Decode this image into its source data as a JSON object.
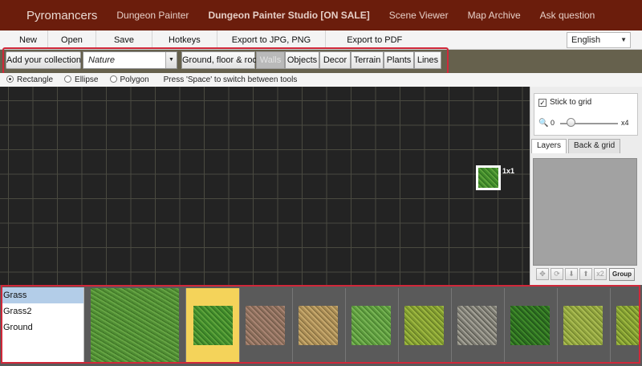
{
  "topnav": {
    "brand": "Pyromancers",
    "items": [
      "Dungeon Painter",
      "Dungeon Painter Studio [ON SALE]",
      "Scene Viewer",
      "Map Archive",
      "Ask question"
    ]
  },
  "menubar": {
    "items": [
      "New",
      "Open",
      "Save",
      "Hotkeys",
      "Export to JPG, PNG",
      "Export to PDF"
    ],
    "language": "English"
  },
  "toolbar": {
    "add_collection": "Add your collection",
    "collection": "Nature",
    "tabs": [
      "Ground, floor & roof",
      "Walls",
      "Objects",
      "Decor",
      "Terrain",
      "Plants",
      "Lines"
    ]
  },
  "tools": {
    "options": [
      "Rectangle",
      "Ellipse",
      "Polygon"
    ],
    "selected": "Rectangle",
    "hint": "Press 'Space' to switch between tools"
  },
  "canvas": {
    "brush_size": "1x1"
  },
  "right_panel": {
    "stick_to_grid": "Stick to grid",
    "zoom_min": "0",
    "zoom_max": "x4",
    "tabs": [
      "Layers",
      "Back & grid"
    ],
    "layer_buttons": [
      "✥",
      "⟳",
      "⬇",
      "⬆",
      "x2"
    ],
    "group_button": "Group"
  },
  "library": {
    "textures": [
      "Grass",
      "Grass2",
      "Ground"
    ],
    "selected": "Grass"
  },
  "colors": {
    "nav_bg": "#6b1d0c",
    "toolbar_bg": "#66614d",
    "highlight": "#d0283a",
    "selected_swatch": "#f4d35a"
  }
}
